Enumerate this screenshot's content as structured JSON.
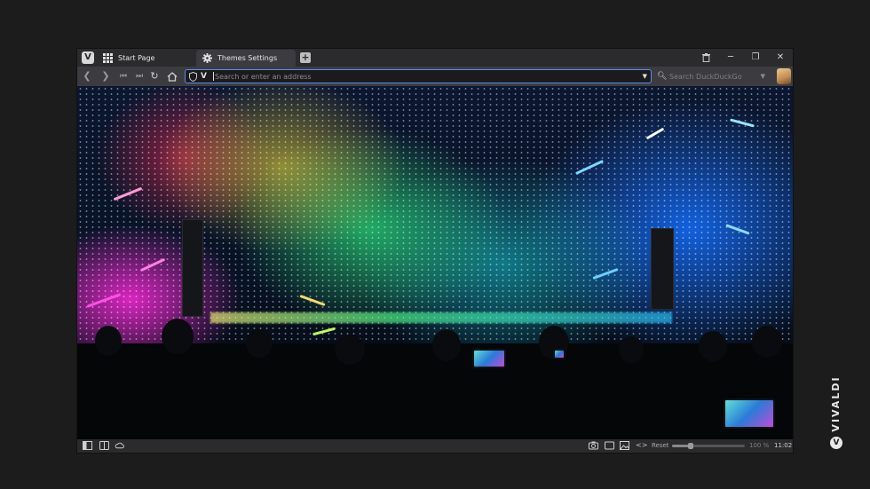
{
  "tabs": [
    {
      "label": "Start Page",
      "icon": "grid-icon",
      "active": false
    },
    {
      "label": "Themes Settings",
      "icon": "gear-icon",
      "active": true
    }
  ],
  "address_bar": {
    "placeholder": "Search or enter an address",
    "value": ""
  },
  "search": {
    "placeholder": "Search DuckDuckGo",
    "value": ""
  },
  "status_bar": {
    "reset_label": "Reset",
    "zoom": "100 %",
    "zoom_fraction": 1.0,
    "clock": "11:02"
  },
  "brand": {
    "wordmark": "VIVALDI"
  },
  "colors": {
    "accent": "#5a8cf0",
    "chrome_dark": "#2b2b2e",
    "chrome_mid": "#3c3c40"
  }
}
